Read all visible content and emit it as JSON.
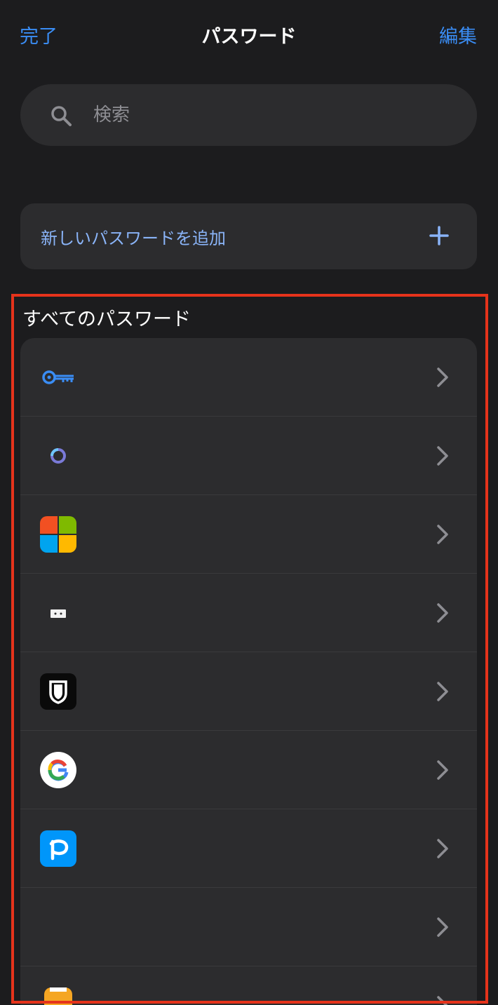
{
  "nav": {
    "done_label": "完了",
    "title": "パスワード",
    "edit_label": "編集"
  },
  "search": {
    "placeholder": "検索"
  },
  "add_password": {
    "label": "新しいパスワードを追加"
  },
  "section": {
    "title": "すべてのパスワード"
  },
  "list": {
    "items": [
      {
        "icon": "key-icon"
      },
      {
        "icon": "ring-app-icon"
      },
      {
        "icon": "microsoft-icon"
      },
      {
        "icon": "small-app-icon"
      },
      {
        "icon": "shield-app-icon"
      },
      {
        "icon": "google-icon"
      },
      {
        "icon": "pixiv-icon"
      },
      {
        "icon": "blank-icon"
      },
      {
        "icon": "partial-app-icon"
      }
    ]
  },
  "colors": {
    "accent": "#3a8df5",
    "highlight_border": "#e5331b"
  }
}
